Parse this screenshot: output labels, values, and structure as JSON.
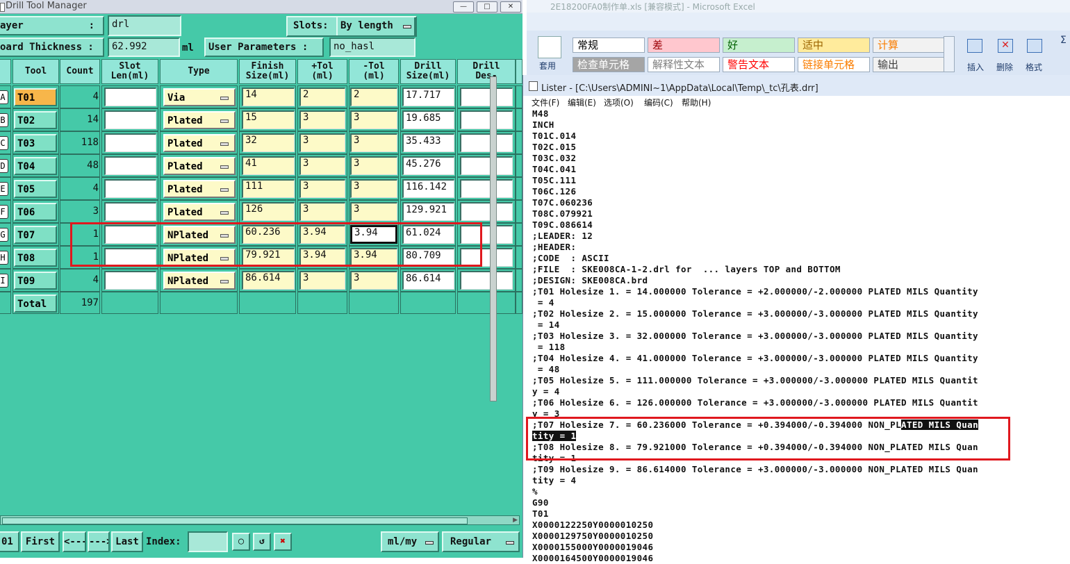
{
  "dtm": {
    "title": "Drill Tool Manager",
    "layer_label": "ayer",
    "layer_colon": ":",
    "layer_value": "drl",
    "slots_label": "Slots:",
    "slots_value": "By length",
    "board_thickness_label": "oard Thickness :",
    "board_thickness_value": "62.992",
    "board_thickness_unit": "ml",
    "user_params_label": "User Parameters :",
    "user_params_value": "no_hasl",
    "headers": [
      "Tool",
      "Count",
      "Slot\nLen(ml)",
      "Type",
      "Finish\nSize(ml)",
      "+Tol\n(ml)",
      "-Tol\n(ml)",
      "Drill\nSize(ml)",
      "Drill\nDes-"
    ],
    "rows": [
      {
        "letter": "A",
        "tool": "T01",
        "count": "4",
        "type": "Via",
        "finish": "14",
        "ptol": "2",
        "ntol": "2",
        "drill": "17.717"
      },
      {
        "letter": "B",
        "tool": "T02",
        "count": "14",
        "type": "Plated",
        "finish": "15",
        "ptol": "3",
        "ntol": "3",
        "drill": "19.685"
      },
      {
        "letter": "C",
        "tool": "T03",
        "count": "118",
        "type": "Plated",
        "finish": "32",
        "ptol": "3",
        "ntol": "3",
        "drill": "35.433"
      },
      {
        "letter": "D",
        "tool": "T04",
        "count": "48",
        "type": "Plated",
        "finish": "41",
        "ptol": "3",
        "ntol": "3",
        "drill": "45.276"
      },
      {
        "letter": "E",
        "tool": "T05",
        "count": "4",
        "type": "Plated",
        "finish": "111",
        "ptol": "3",
        "ntol": "3",
        "drill": "116.142"
      },
      {
        "letter": "F",
        "tool": "T06",
        "count": "3",
        "type": "Plated",
        "finish": "126",
        "ptol": "3",
        "ntol": "3",
        "drill": "129.921"
      },
      {
        "letter": "G",
        "tool": "T07",
        "count": "1",
        "type": "NPlated",
        "finish": "60.236",
        "ptol": "3.94",
        "ntol": "3.94",
        "drill": "61.024"
      },
      {
        "letter": "H",
        "tool": "T08",
        "count": "1",
        "type": "NPlated",
        "finish": "79.921",
        "ptol": "3.94",
        "ntol": "3.94",
        "drill": "80.709"
      },
      {
        "letter": "I",
        "tool": "T09",
        "count": "4",
        "type": "NPlated",
        "finish": "86.614",
        "ptol": "3",
        "ntol": "3",
        "drill": "86.614"
      }
    ],
    "total_label": "Total",
    "total_count": "197",
    "nav": {
      "index_prefix": "01",
      "first": "First",
      "prev": "<---",
      "next": "--->",
      "last": "Last",
      "index_label": "Index:",
      "units": "ml/my",
      "mode": "Regular"
    }
  },
  "excel": {
    "title": "2E18200FA0制作单.xls  [兼容模式] - Microsoft Excel",
    "styles_row1": [
      {
        "label": "常规",
        "bg": "#ffffff",
        "color": "#000000"
      },
      {
        "label": "差",
        "bg": "#ffc7ce",
        "color": "#9c0006"
      },
      {
        "label": "好",
        "bg": "#c6efce",
        "color": "#006100"
      },
      {
        "label": "适中",
        "bg": "#ffeb9c",
        "color": "#9c6500"
      },
      {
        "label": "计算",
        "bg": "#f2f2f2",
        "color": "#fa7d00"
      }
    ],
    "styles_row2": [
      {
        "label": "检查单元格",
        "bg": "#a5a5a5",
        "color": "#ffffff"
      },
      {
        "label": "解释性文本",
        "bg": "#ffffff",
        "color": "#7f7f7f"
      },
      {
        "label": "警告文本",
        "bg": "#ffffff",
        "color": "#ff0000"
      },
      {
        "label": "链接单元格",
        "bg": "#ffffff",
        "color": "#fa7d00"
      },
      {
        "label": "输出",
        "bg": "#f2f2f2",
        "color": "#3f3f3f"
      }
    ],
    "apply_label": "套用",
    "insert_label": "插入",
    "delete_label": "删除",
    "format_label": "格式",
    "sigma": "Σ"
  },
  "lister": {
    "title": "Lister - [C:\\Users\\ADMINI~1\\AppData\\Local\\Temp\\_tc\\孔表.drr]",
    "menu": [
      "文件(F)",
      "编辑(E)",
      "选项(O)",
      "编码(C)",
      "帮助(H)"
    ],
    "lines": [
      "M48",
      "INCH",
      "T01C.014",
      "T02C.015",
      "T03C.032",
      "T04C.041",
      "T05C.111",
      "T06C.126",
      "T07C.060236",
      "T08C.079921",
      "T09C.086614",
      ";LEADER: 12",
      ";HEADER:",
      ";CODE  : ASCII",
      ";FILE  : SKE008CA-1-2.drl for  ... layers TOP and BOTTOM",
      ";DESIGN: SKE008CA.brd",
      ";T01 Holesize 1. = 14.000000 Tolerance = +2.000000/-2.000000 PLATED MILS Quantity",
      " = 4",
      ";T02 Holesize 2. = 15.000000 Tolerance = +3.000000/-3.000000 PLATED MILS Quantity",
      " = 14",
      ";T03 Holesize 3. = 32.000000 Tolerance = +3.000000/-3.000000 PLATED MILS Quantity",
      " = 118",
      ";T04 Holesize 4. = 41.000000 Tolerance = +3.000000/-3.000000 PLATED MILS Quantity",
      " = 48",
      ";T05 Holesize 5. = 111.000000 Tolerance = +3.000000/-3.000000 PLATED MILS Quantit",
      "y = 4",
      ";T06 Holesize 6. = 126.000000 Tolerance = +3.000000/-3.000000 PLATED MILS Quantit",
      "y = 3",
      ";T07 Holesize 7. = 60.236000 Tolerance = +0.394000/-0.394000 NON_PL",
      "tity = 1",
      ";T08 Holesize 8. = 79.921000 Tolerance = +0.394000/-0.394000 NON_PLATED MILS Quan",
      "tity = 1",
      ";T09 Holesize 9. = 86.614000 Tolerance = +3.000000/-3.000000 NON_PLATED MILS Quan",
      "tity = 4",
      "%",
      "G90",
      "T01",
      "X0000122250Y0000010250",
      "X0000129750Y0000010250",
      "X0000155000Y0000019046",
      "X0000164500Y0000019046"
    ],
    "t07_highlight": "ATED MILS Quan"
  }
}
